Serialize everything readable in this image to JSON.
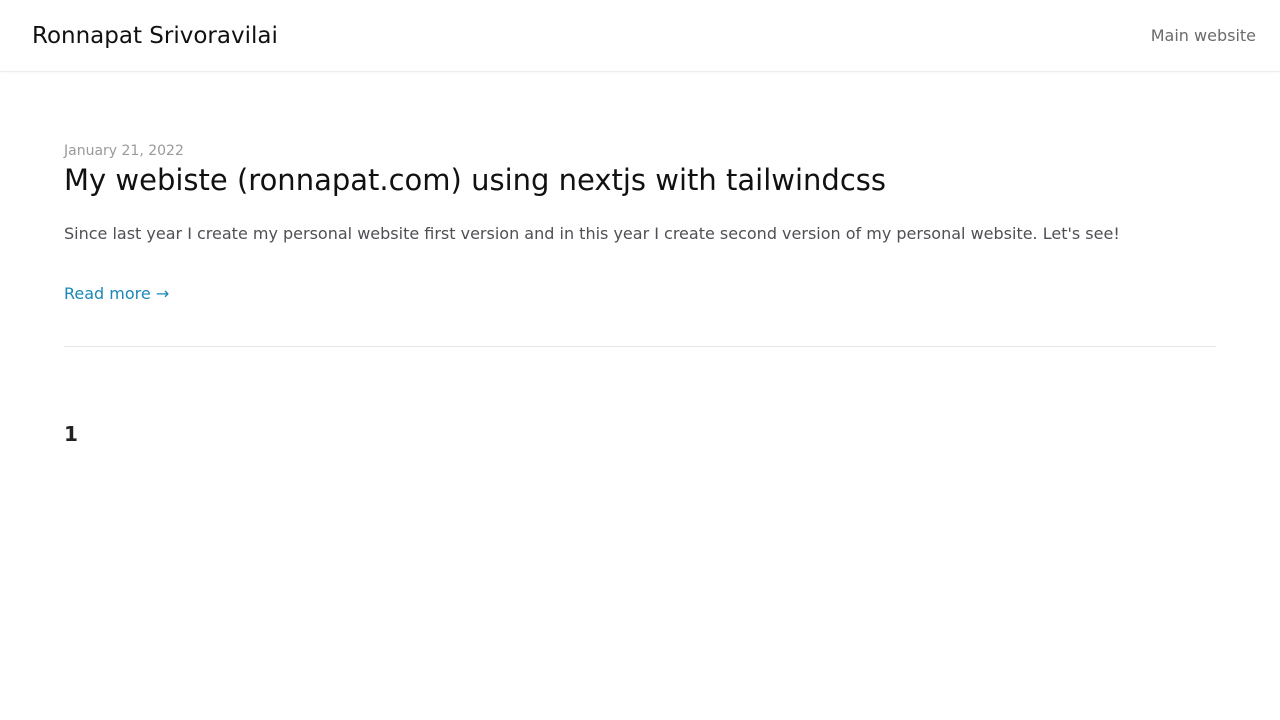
{
  "header": {
    "site_title": "Ronnapat Srivoravilai",
    "nav_link": "Main website"
  },
  "posts": [
    {
      "date": "January 21, 2022",
      "title": "My webiste (ronnapat.com) using nextjs with tailwindcss",
      "excerpt": "Since last year I create my personal website first version and in this year I create second version of my personal website. Let's see!",
      "read_more": "Read more →"
    }
  ],
  "pagination": {
    "current_page": "1"
  },
  "colors": {
    "link": "#1a87b8",
    "text": "#111111",
    "muted": "#9a9a9a"
  }
}
